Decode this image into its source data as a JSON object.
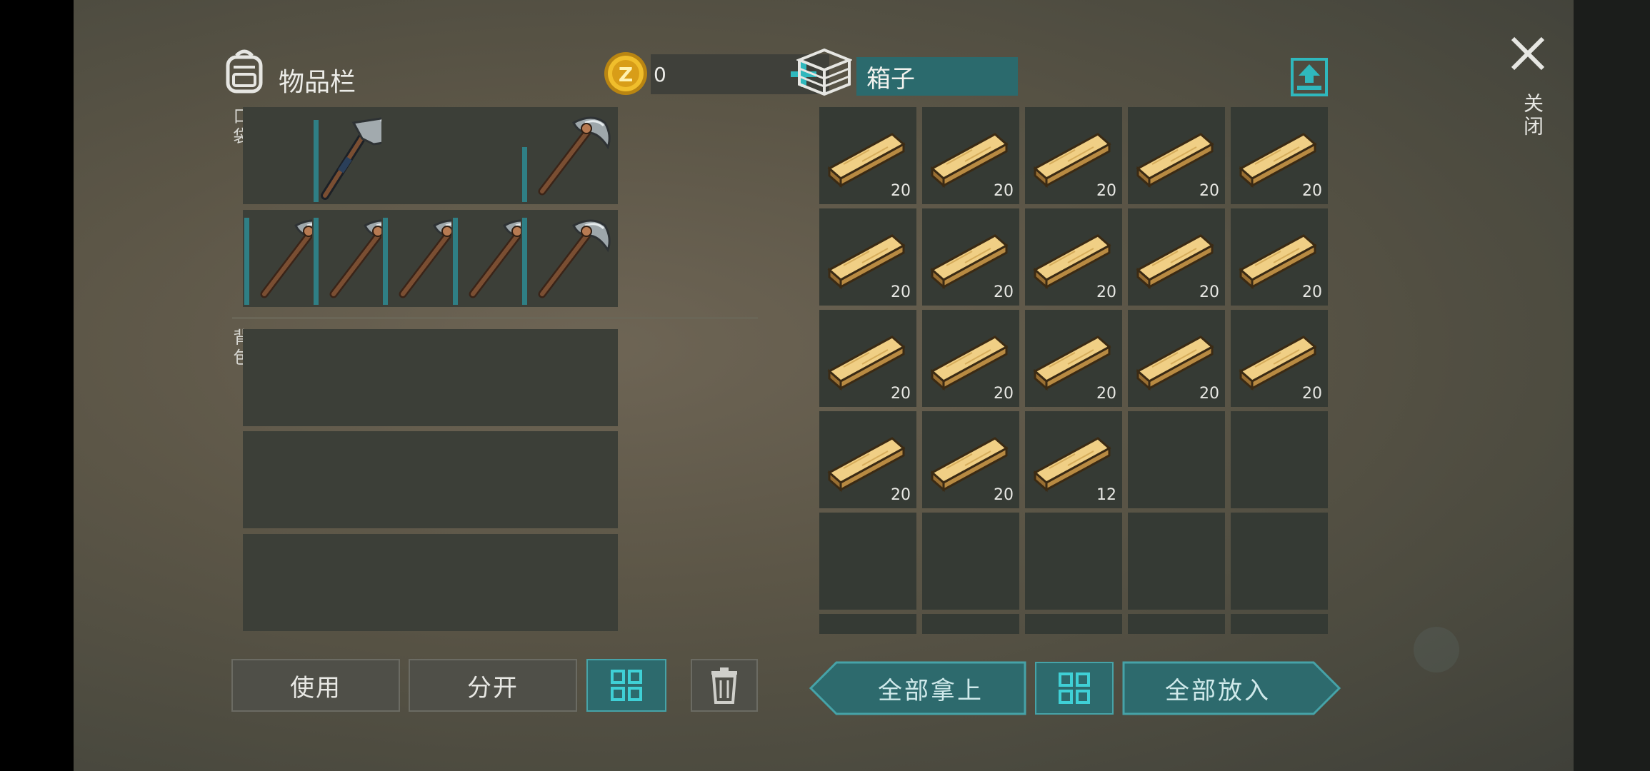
{
  "inventory": {
    "title": "物品栏",
    "coins": "0",
    "pocket_label": "口袋",
    "backpack_label": "背包",
    "pocket_slots": [
      {
        "item": "",
        "durability": 0
      },
      {
        "item": "hatchet-icon",
        "durability": 0.9
      },
      {
        "item": "",
        "durability": 0
      },
      {
        "item": "",
        "durability": 0
      },
      {
        "item": "pickaxe-icon",
        "durability": 0.6
      },
      {
        "item": "pickaxe-icon",
        "durability": 0.95
      },
      {
        "item": "pickaxe-icon",
        "durability": 0.95
      },
      {
        "item": "pickaxe-icon",
        "durability": 0.95
      },
      {
        "item": "pickaxe-icon",
        "durability": 0.95
      },
      {
        "item": "pickaxe-icon",
        "durability": 0.95
      }
    ],
    "backpack_slot_count": 15,
    "use_label": "使用",
    "split_label": "分开"
  },
  "box": {
    "title": "箱子",
    "slots": [
      {
        "item": "wood-plank-icon",
        "qty": "20"
      },
      {
        "item": "wood-plank-icon",
        "qty": "20"
      },
      {
        "item": "wood-plank-icon",
        "qty": "20"
      },
      {
        "item": "wood-plank-icon",
        "qty": "20"
      },
      {
        "item": "wood-plank-icon",
        "qty": "20"
      },
      {
        "item": "wood-plank-icon",
        "qty": "20"
      },
      {
        "item": "wood-plank-icon",
        "qty": "20"
      },
      {
        "item": "wood-plank-icon",
        "qty": "20"
      },
      {
        "item": "wood-plank-icon",
        "qty": "20"
      },
      {
        "item": "wood-plank-icon",
        "qty": "20"
      },
      {
        "item": "wood-plank-icon",
        "qty": "20"
      },
      {
        "item": "wood-plank-icon",
        "qty": "20"
      },
      {
        "item": "wood-plank-icon",
        "qty": "20"
      },
      {
        "item": "wood-plank-icon",
        "qty": "20"
      },
      {
        "item": "wood-plank-icon",
        "qty": "20"
      },
      {
        "item": "wood-plank-icon",
        "qty": "20"
      },
      {
        "item": "wood-plank-icon",
        "qty": "20"
      },
      {
        "item": "wood-plank-icon",
        "qty": "12"
      }
    ],
    "visible_rows": 6,
    "take_all_label": "全部拿上",
    "put_all_label": "全部放入"
  },
  "close_label": "关闭",
  "colors": {
    "accent_teal": "#2d6a6d",
    "durability_bar": "#2f7f85",
    "slot_bg": "#3c3f38"
  }
}
